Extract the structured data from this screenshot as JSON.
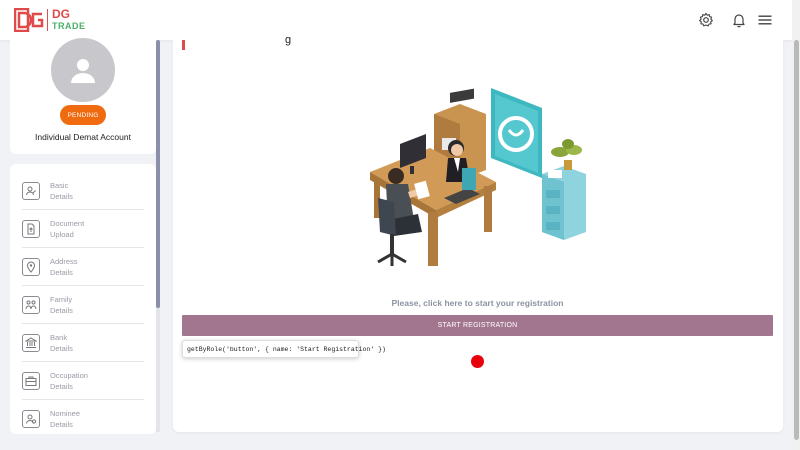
{
  "header": {
    "logo_main": "DG",
    "logo_sub": "TRADE",
    "icons": [
      "settings-icon",
      "bell-icon",
      "hamburger-menu-icon"
    ]
  },
  "profile": {
    "status_badge": "PENDING",
    "account_type": "Individual Demat Account"
  },
  "steps": [
    {
      "label_line1": "Basic",
      "label_line2": "Details",
      "icon": "user-edit-icon"
    },
    {
      "label_line1": "Document",
      "label_line2": "Upload",
      "icon": "document-upload-icon"
    },
    {
      "label_line1": "Address",
      "label_line2": "Details",
      "icon": "location-pin-icon"
    },
    {
      "label_line1": "Family",
      "label_line2": "Details",
      "icon": "family-icon"
    },
    {
      "label_line1": "Bank",
      "label_line2": "Details",
      "icon": "bank-icon"
    },
    {
      "label_line1": "Occupation",
      "label_line2": "Details",
      "icon": "briefcase-icon"
    },
    {
      "label_line1": "Nominee",
      "label_line2": "Details",
      "icon": "nominee-icon"
    }
  ],
  "main": {
    "partial_title_glyph": "g",
    "prompt_text": "Please, click here to start your registration",
    "start_button_label": "START REGISTRATION",
    "tooltip_text": "getByRole('button', { name: 'Start Registration' })"
  },
  "colors": {
    "brand_red": "#e04a4a",
    "brand_green": "#4caf6a",
    "badge_orange": "#f06a0f",
    "button_mauve": "#a3768f",
    "click_marker": "#e8000d"
  }
}
